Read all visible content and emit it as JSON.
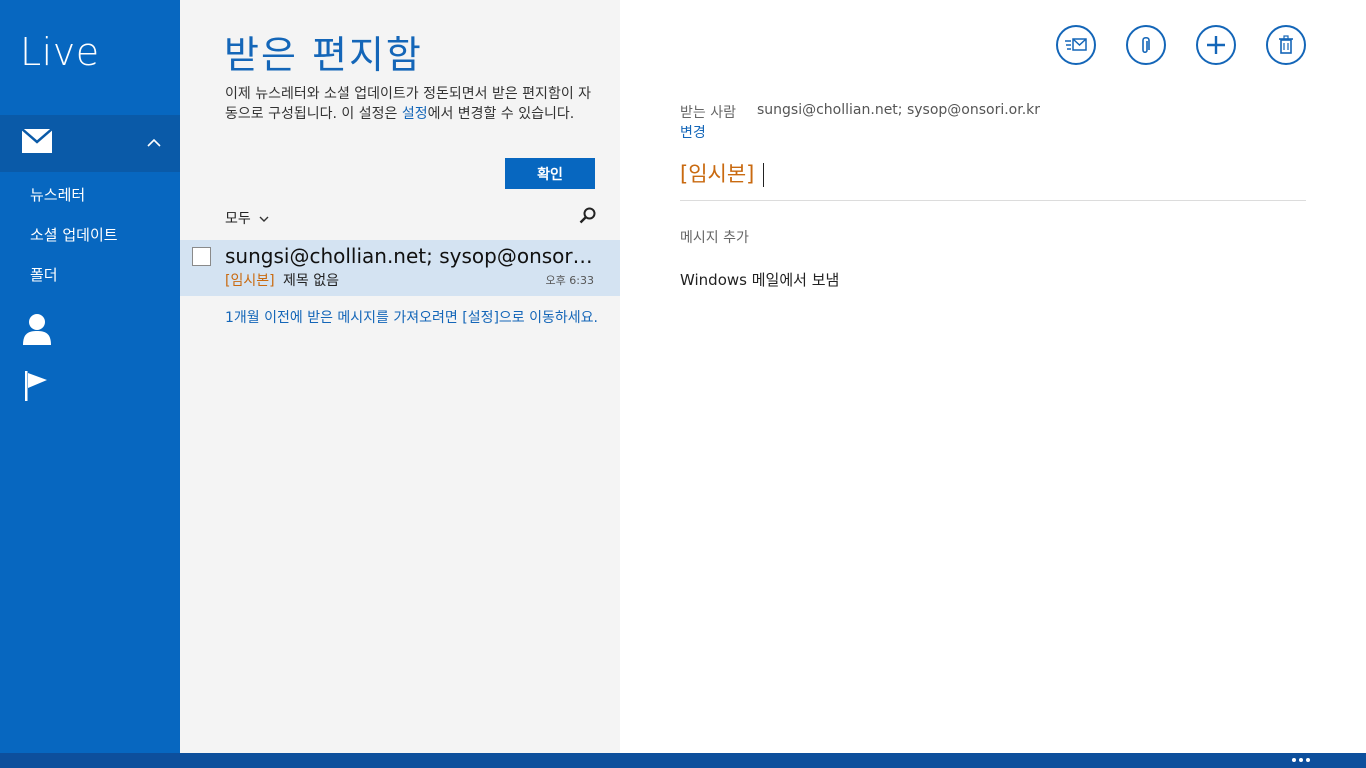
{
  "nav": {
    "brand": "Live",
    "sub_items": [
      {
        "label": "뉴스레터"
      },
      {
        "label": "소셜 업데이트"
      },
      {
        "label": "폴더"
      }
    ]
  },
  "list": {
    "title": "받은 편지함",
    "notice_before": "이제 뉴스레터와 소셜 업데이트가 정돈되면서 받은 편지함이 자동으로 구성됩니다. 이 설정은 ",
    "notice_link": "설정",
    "notice_after": "에서 변경할 수 있습니다.",
    "ok_label": "확인",
    "filter_label": "모두",
    "message": {
      "from": "sungsi@chollian.net; sysop@onsori.or.kr",
      "draft_tag": "[임시본]",
      "subject": "제목 없음",
      "time": "오후 6:33"
    },
    "older_notice": "1개월 이전에 받은 메시지를 가져오려면 [설정]으로 이동하세요."
  },
  "compose": {
    "to_label": "받는 사람",
    "to_value": "sungsi@chollian.net; sysop@onsori.or.kr",
    "change_label": "변경",
    "subject": "[임시본]",
    "body_placeholder": "메시지 추가",
    "signature": "Windows 메일에서 보냄"
  },
  "icons": {
    "send": "send-mail-icon",
    "attach": "paperclip-icon",
    "add": "plus-icon",
    "delete": "trash-icon"
  },
  "colors": {
    "nav_bg": "#0767c0",
    "accent": "#1466b8",
    "draft": "#c96a10",
    "selected_row": "#d4e3f2"
  }
}
